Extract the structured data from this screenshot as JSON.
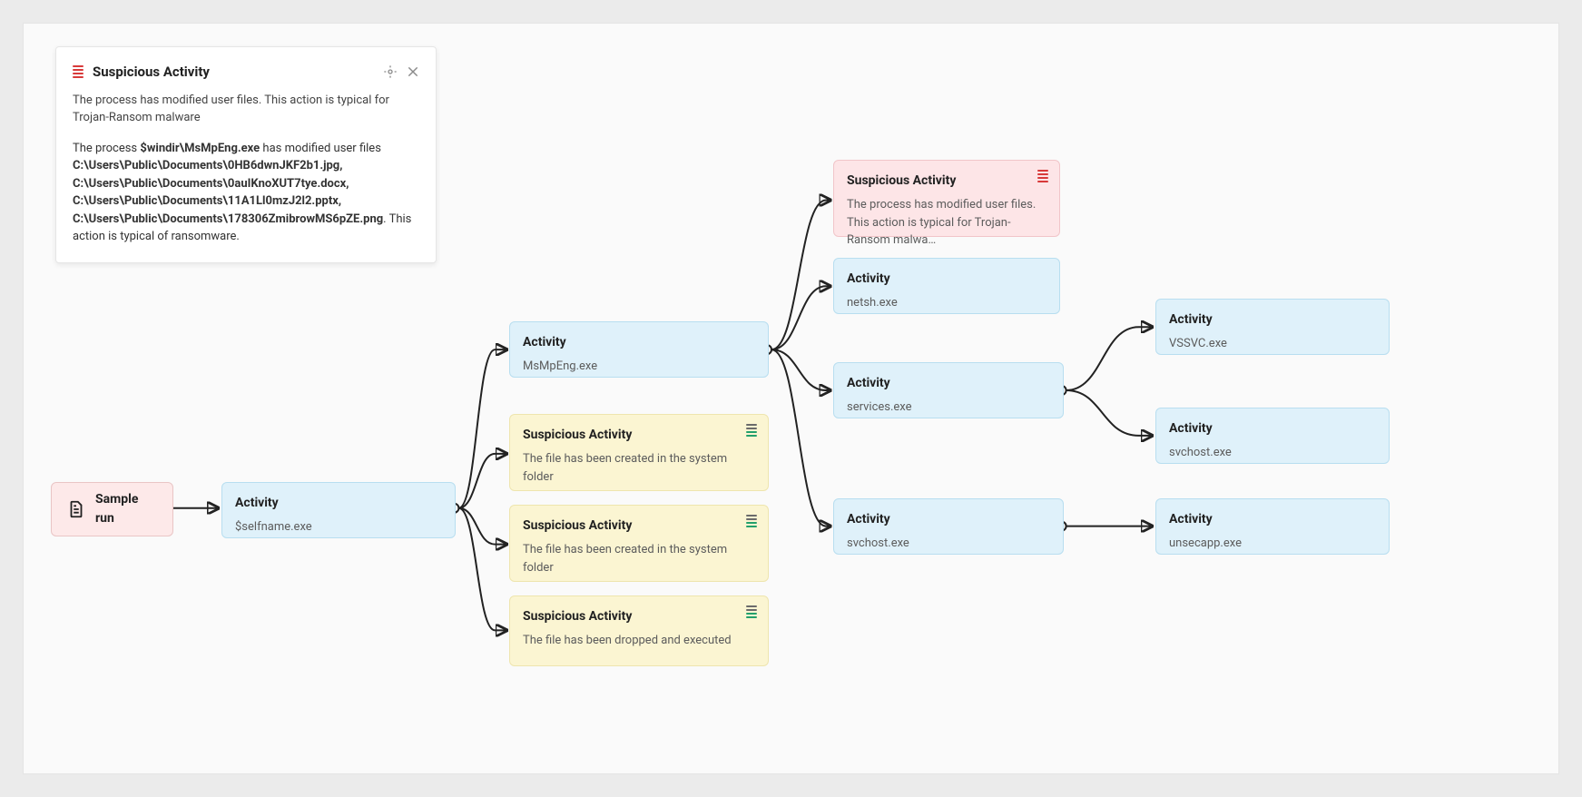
{
  "panel": {
    "title": "Suspicious Activity",
    "description": "The process has modified user files. This action is typical for Trojan-Ransom malware",
    "body_pre": "The process ",
    "proc": "$windir\\MsMpEng.exe",
    "body_mid": " has modified user files ",
    "files": "C:\\Users\\Public\\Documents\\0HB6dwnJKF2b1.jpg, C:\\Users\\Public\\Documents\\0auIKnoXUT7tye.docx, C:\\Users\\Public\\Documents\\11A1Ll0mzJ2l2.pptx, C:\\Users\\Public\\Documents\\178306ZmibrowMS6pZE.png",
    "body_post": ". This action is typical of ransomware."
  },
  "nodes": {
    "sample": {
      "title": "Sample run"
    },
    "activity_root": {
      "title": "Activity",
      "sub": "$selfname.exe"
    },
    "msmpeng": {
      "title": "Activity",
      "sub": "MsMpEng.exe"
    },
    "susp_y1": {
      "title": "Suspicious Activity",
      "sub": "The file has been created in the system folder"
    },
    "susp_y2": {
      "title": "Suspicious Activity",
      "sub": "The file has been created in the system folder"
    },
    "susp_y3": {
      "title": "Suspicious Activity",
      "sub": "The file has been dropped and executed"
    },
    "susp_r": {
      "title": "Suspicious Activity",
      "sub": "The process has modified user files. This action is typical for Trojan-Ransom malwa…"
    },
    "netsh": {
      "title": "Activity",
      "sub": "netsh.exe"
    },
    "services": {
      "title": "Activity",
      "sub": "services.exe"
    },
    "svchost_top": {
      "title": "Activity",
      "sub": "svchost.exe"
    },
    "vssvc": {
      "title": "Activity",
      "sub": "VSSVC.exe"
    },
    "svchost_branch": {
      "title": "Activity",
      "sub": "svchost.exe"
    },
    "unsecapp": {
      "title": "Activity",
      "sub": "unsecapp.exe"
    }
  }
}
